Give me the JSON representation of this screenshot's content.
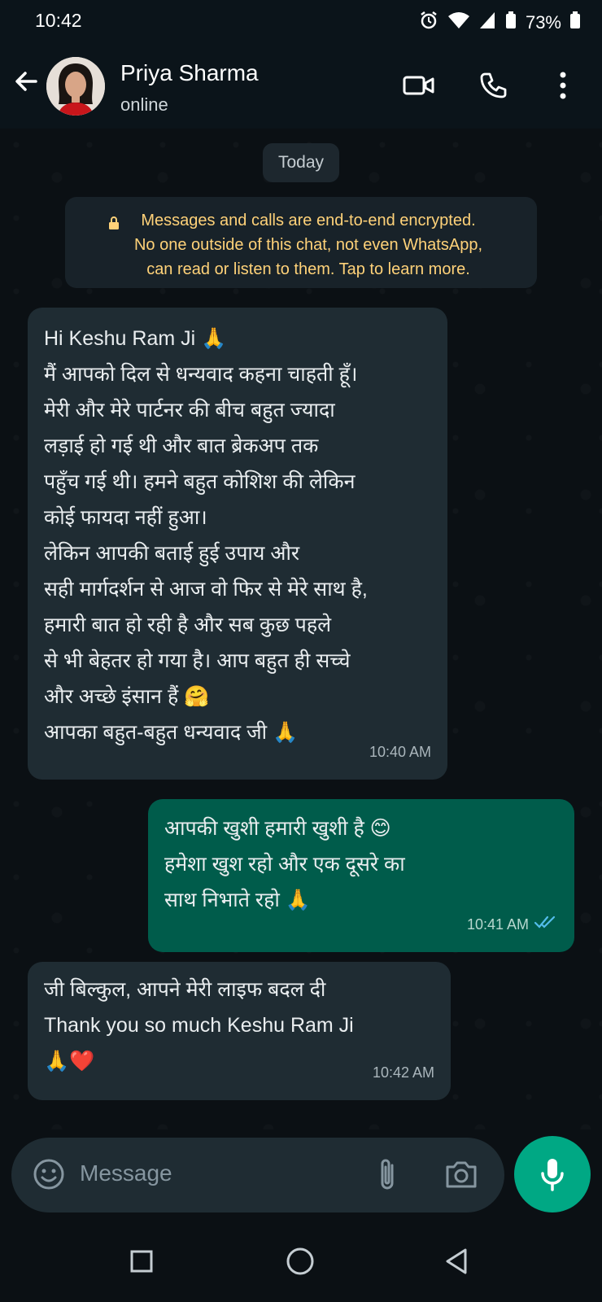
{
  "status": {
    "time": "10:42",
    "battery": "73%"
  },
  "header": {
    "name": "Priya Sharma",
    "presence": "online"
  },
  "chat": {
    "date_chip": "Today",
    "encryption_notice": "Messages and calls are end-to-end encrypted.\nNo one outside of this chat, not even WhatsApp,\ncan read or listen to them. Tap to learn more.",
    "messages": [
      {
        "direction": "incoming",
        "text": "Hi Keshu Ram Ji 🙏\nमैं आपको दिल से धन्यवाद कहना चाहती हूँ।\nमेरी और मेरे पार्टनर की बीच बहुत ज्यादा\nलड़ाई हो गई थी और बात ब्रेकअप तक\nपहुँच गई थी। हमने बहुत कोशिश की लेकिन\nकोई फायदा नहीं हुआ।\nलेकिन आपकी बताई हुई उपाय और\nसही मार्गदर्शन से आज वो फिर से मेरे साथ है,\nहमारी बात हो रही है और सब कुछ पहले\nसे भी बेहतर हो गया है। आप बहुत ही सच्चे\nऔर अच्छे इंसान हैं 🤗\nआपका बहुत-बहुत धन्यवाद जी 🙏",
        "time": "10:40 AM"
      },
      {
        "direction": "outgoing",
        "text": "आपकी खुशी हमारी खुशी है 😊\nहमेशा खुश रहो और एक दूसरे का\nसाथ निभाते रहो 🙏",
        "time": "10:41 AM",
        "status": "read"
      },
      {
        "direction": "incoming",
        "text": "जी बिल्कुल, आपने मेरी लाइफ बदल दी\nThank you so much Keshu Ram Ji\n🙏❤️",
        "time": "10:42 AM"
      }
    ]
  },
  "composer": {
    "placeholder": "Message"
  },
  "colors": {
    "background": "#0b1014",
    "incoming_bubble": "#1f2c33",
    "outgoing_bubble": "#005c4b",
    "accent": "#00a884",
    "encryption_text": "#ffd279"
  }
}
